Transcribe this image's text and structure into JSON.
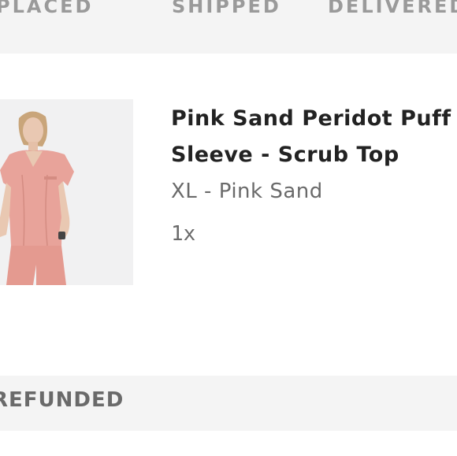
{
  "order_status": {
    "steps": [
      {
        "label": "PLACED"
      },
      {
        "label": "SHIPPED"
      },
      {
        "label": "DELIVERED"
      }
    ]
  },
  "product": {
    "title_line1": "Pink Sand Peridot Puff",
    "title_line2": "Sleeve - Scrub Top",
    "variant": "XL - Pink Sand",
    "quantity": "1x",
    "image_icon": "product-photo",
    "colors": {
      "scrub": "#e8a39a",
      "background": "#f1f1f2"
    }
  },
  "section": {
    "refunded_label": "REFUNDED"
  }
}
